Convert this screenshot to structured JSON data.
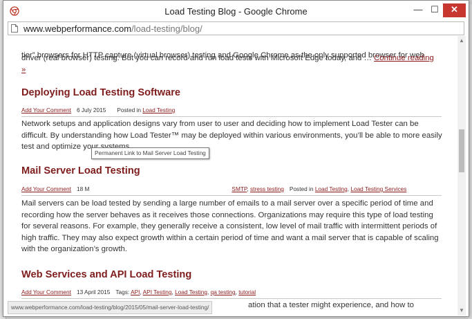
{
  "window": {
    "title": "Load Testing Blog - Google Chrome",
    "minimize_glyph": "—",
    "maximize_glyph": "☐",
    "close_glyph": "✕"
  },
  "address": {
    "host": "www.webperformance.com",
    "path": "/load-testing/blog/"
  },
  "content": {
    "intro_line1": "tier” browsers for HTTP capture (virtual browser) testing and Google Chrome as the only supported browser for web",
    "intro_line2": "driver (real browser) testing. But you can record and run load tests with Microsoft Edge today, and … ",
    "continue_label": "Continue reading",
    "continue_tail": "»",
    "posts": [
      {
        "title": "Deploying Load Testing Software",
        "comment_link": "Add Your Comment",
        "date": "6 July 2015",
        "posted_in_label": "Posted in",
        "categories": [
          "Load Testing"
        ],
        "body": "Network setups and application designs vary from user to user and deciding how to implement Load Tester can be difficult. By understanding how Load Tester™ may be deployed within various environments, you’ll be able to more easily test and optimize your systems."
      },
      {
        "title": "Mail Server Load Testing",
        "comment_link": "Add Your Comment",
        "date_fragment": "18 M",
        "tags_visible": [
          "SMTP",
          "stress testing"
        ],
        "posted_in_label": "Posted in",
        "categories": [
          "Load Testing",
          "Load Testing Services"
        ],
        "body": "Mail servers can be load tested by sending a large number of emails to a mail server over a specific period of time and recording how the server behaves as it receives those connections. Organizations may require this type of load testing for several reasons. For example, they generally receive a consistent, low level of mail traffic with intermittent periods of high traffic. They may also expect growth within a certain period of time and want a mail server that is capable of scaling with the organization’s growth."
      },
      {
        "title": "Web Services and API Load Testing",
        "comment_link": "Add Your Comment",
        "date": "13 April 2015",
        "tags_label": "Tags:",
        "tags": [
          "API",
          "API Testing",
          "Load Testing",
          "qa testing",
          "tutorial"
        ],
        "body_visible": "ation that a tester might experience, and how to"
      }
    ]
  },
  "tooltip": "Permanent Link to Mail Server Load Testing",
  "status_url": "www.webperformance.com/load-testing/blog/2015/05/mail-server-load-testing/",
  "colors": {
    "heading": "#7f1d1d",
    "link": "#8b1a1a",
    "close_button": "#c7372f"
  }
}
